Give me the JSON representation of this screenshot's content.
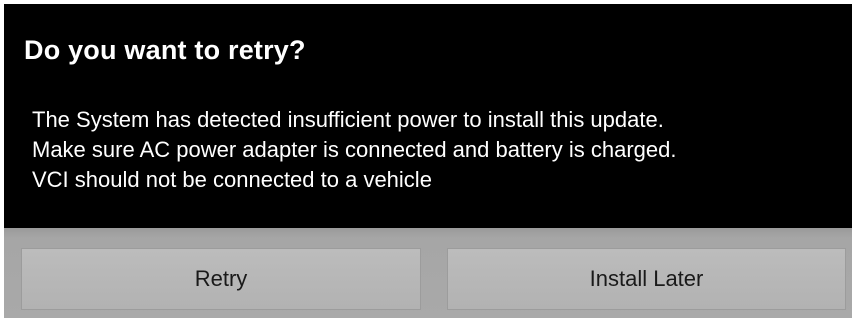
{
  "dialog": {
    "title": "Do you want to retry?",
    "message_lines": [
      "The System has detected insufficient power to install this update.",
      "Make sure AC power adapter is connected and battery is charged.",
      "VCI should not be connected to a vehicle"
    ],
    "buttons": {
      "retry_label": "Retry",
      "install_later_label": "Install Later"
    }
  },
  "colors": {
    "dialog_background": "#000000",
    "text": "#ffffff",
    "button_bar": "#a8a8a8",
    "button_face": "#b8b8b8",
    "button_text": "#1a1a1a"
  }
}
